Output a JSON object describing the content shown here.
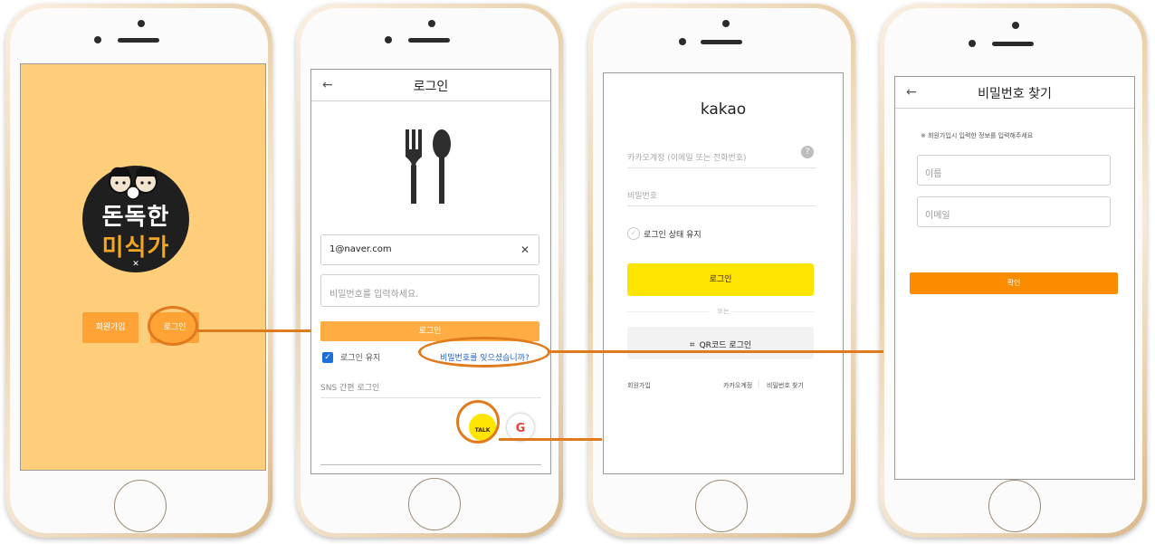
{
  "screen1": {
    "logo_line1": "돈독한",
    "logo_line2": "미식가",
    "signup_label": "회원가입",
    "login_label": "로그인",
    "background_color": "#ffce7b"
  },
  "screen2": {
    "title": "로그인",
    "back_icon": "←",
    "email_value": "1@naver.com",
    "clear_icon": "✕",
    "password_placeholder": "비밀번호를 입력하세요.",
    "login_button": "로그인",
    "keep_login": "로그인 유지",
    "forgot_link": "비밀번호를 잊으셨습니까?",
    "sns_label": "SNS 간편 로그인",
    "kakao_label": "TALK",
    "google_label": "G",
    "accent_color": "#ffad42"
  },
  "screen3": {
    "brand": "kakao",
    "account_placeholder": "카카오계정 (이메일 또는 전화번호)",
    "help_icon": "?",
    "password_placeholder": "비밀번호",
    "keep_login": "로그인 상태 유지",
    "login_button": "로그인",
    "or_label": "또는",
    "qr_login": "QR코드 로그인",
    "signup": "회원가입",
    "kakao_account": "카카오계정",
    "find_password": "비밀번호 찾기",
    "accent_color": "#fee500"
  },
  "screen4": {
    "title": "비밀번호 찾기",
    "back_icon": "←",
    "notice": "※ 회원가입시 입력한 정보를 입력해주세요",
    "name_placeholder": "이름",
    "email_placeholder": "이메일",
    "confirm_button": "확인",
    "accent_color": "#fb8c00"
  }
}
